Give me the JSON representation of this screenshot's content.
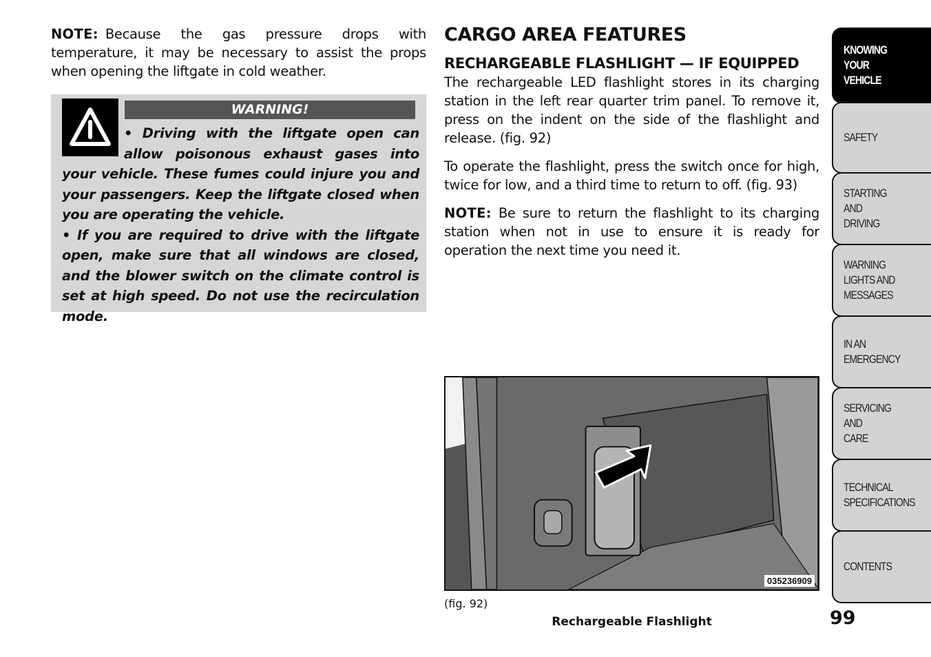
{
  "left_column": {
    "note_label": "NOTE:",
    "note_text": "Because the gas pressure drops with temperature, it may be necessary to assist the props when opening the liftgate in cold weather.",
    "warning": {
      "icon": "warning-triangle-icon",
      "title": "WARNING!",
      "bullet1": "• Driving with the liftgate open can allow poisonous exhaust gases into your vehicle. These fumes could injure you and your passengers. Keep the liftgate closed when you are operating the vehicle.",
      "bullet2": "• If you are required to drive with the liftgate open, make sure that all windows are closed, and the blower switch on the climate control is set at high speed. Do not use the recirculation mode."
    }
  },
  "right_column": {
    "heading": "CARGO AREA FEATURES",
    "subheading": "RECHARGEABLE FLASHLIGHT — IF EQUIPPED",
    "para1": "The rechargeable LED flashlight stores in its charging station in the left rear quarter trim panel. To remove it, press on the indent on the side of the flashlight and release. (fig.  92)",
    "para2": "To operate the flashlight, press the switch once for high, twice for low, and a third time to return to off. (fig.  93)",
    "note_label": "NOTE:",
    "note_text": "Be sure to return the flashlight to its charging station when not in use to ensure it is ready for operation the next time you need it."
  },
  "figure": {
    "id_code": "035236909",
    "ref": "(fig. 92)",
    "caption": "Rechargeable Flashlight"
  },
  "page_number": "99",
  "tabs": [
    {
      "label": "KNOWING\nYOUR\nVEHICLE",
      "active": true
    },
    {
      "label": "SAFETY",
      "active": false
    },
    {
      "label": "STARTING\nAND\nDRIVING",
      "active": false
    },
    {
      "label": "WARNING\nLIGHTS AND\nMESSAGES",
      "active": false
    },
    {
      "label": "IN AN\nEMERGENCY",
      "active": false
    },
    {
      "label": "SERVICING\nAND\nCARE",
      "active": false
    },
    {
      "label": "TECHNICAL\nSPECIFICATIONS",
      "active": false
    },
    {
      "label": "CONTENTS",
      "active": false
    }
  ]
}
